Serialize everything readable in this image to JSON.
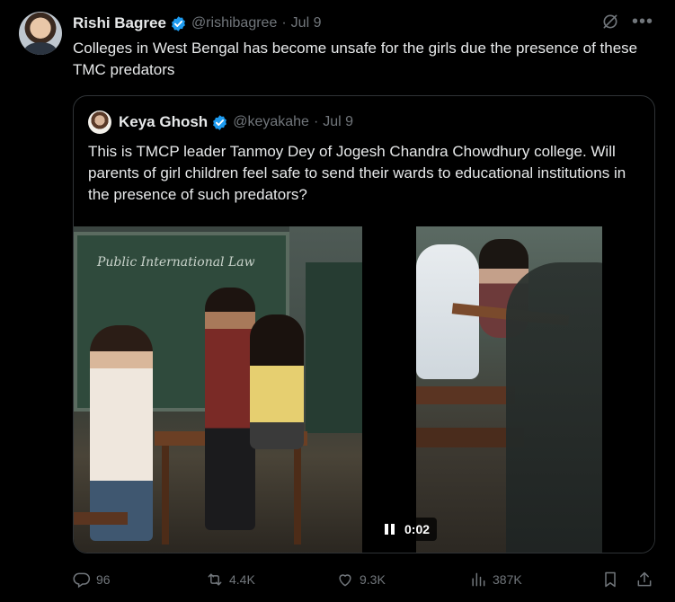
{
  "tweet": {
    "author_name": "Rishi Bagree",
    "author_handle": "@rishibagree",
    "separator": "·",
    "date": "Jul 9",
    "text": "Colleges in West Bengal has become unsafe for the girls due the presence of these TMC predators"
  },
  "quoted_tweet": {
    "author_name": "Keya Ghosh",
    "author_handle": "@keyakahe",
    "separator": "·",
    "date": "Jul 9",
    "text": "This is TMCP leader Tanmoy Dey of Jogesh Chandra Chowdhury college. Will parents of girl children feel safe to send their wards to educational institutions in the presence of such predators?",
    "media": {
      "board_text": "Public International Law",
      "video_duration": "0:02"
    }
  },
  "actions": {
    "replies": "96",
    "retweets": "4.4K",
    "likes": "9.3K",
    "views": "387K"
  },
  "icons": {
    "verified": "verified-badge-icon",
    "grok": "grok-icon",
    "more": "more-icon",
    "reply": "reply-icon",
    "retweet": "retweet-icon",
    "like": "heart-icon",
    "views": "views-icon",
    "bookmark": "bookmark-icon",
    "share": "share-icon"
  },
  "colors": {
    "background": "#000000",
    "text_primary": "#e7e9ea",
    "text_secondary": "#71767b",
    "verified_blue": "#1d9bf0",
    "border": "#2f3336"
  }
}
